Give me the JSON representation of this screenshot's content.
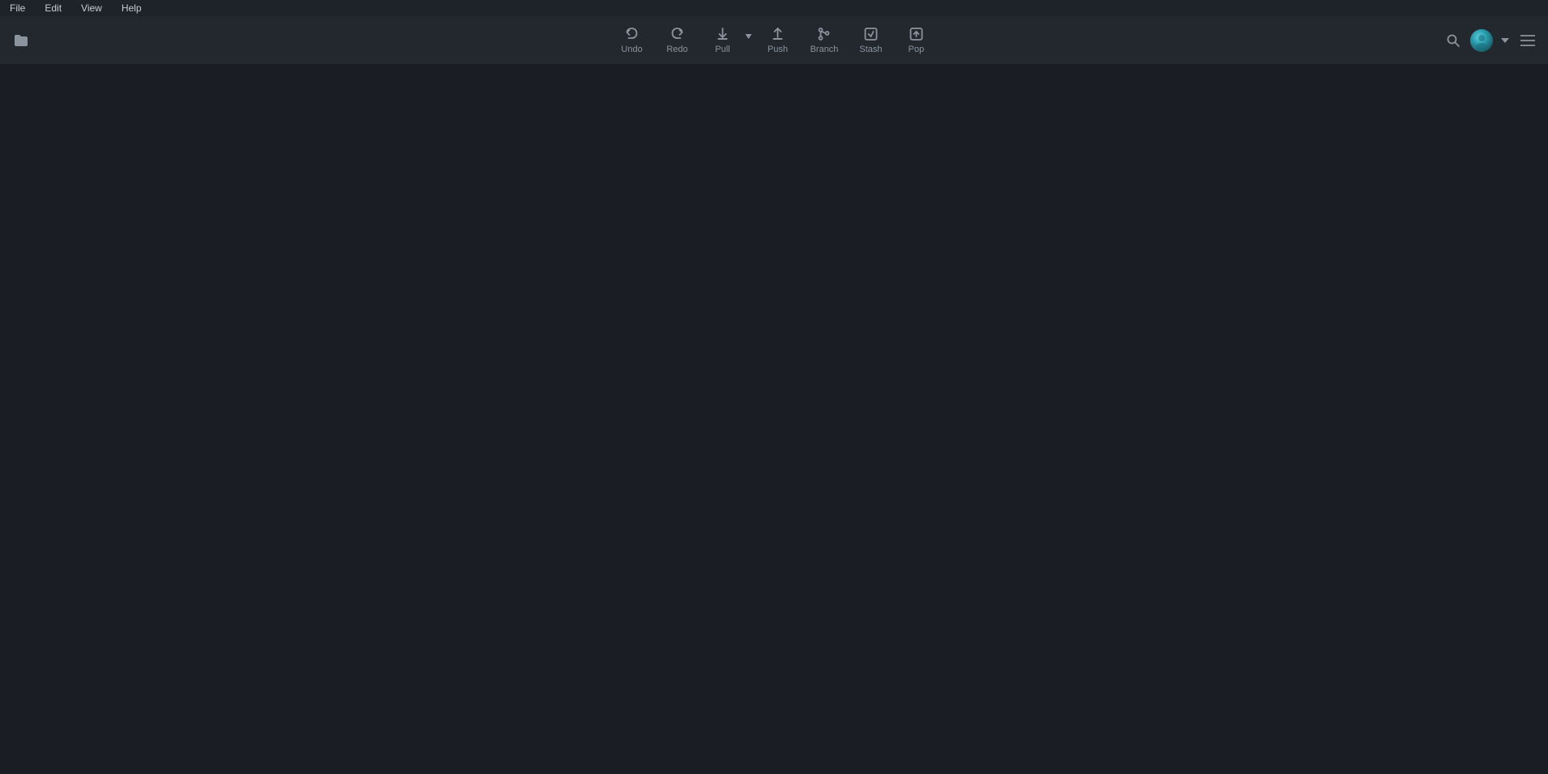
{
  "menu": {
    "items": [
      {
        "id": "file",
        "label": "File"
      },
      {
        "id": "edit",
        "label": "Edit"
      },
      {
        "id": "view",
        "label": "View"
      },
      {
        "id": "help",
        "label": "Help"
      }
    ]
  },
  "toolbar": {
    "buttons": [
      {
        "id": "undo",
        "label": "Undo"
      },
      {
        "id": "redo",
        "label": "Redo"
      },
      {
        "id": "pull",
        "label": "Pull"
      },
      {
        "id": "push",
        "label": "Push"
      },
      {
        "id": "branch",
        "label": "Branch"
      },
      {
        "id": "stash",
        "label": "Stash"
      },
      {
        "id": "pop",
        "label": "Pop"
      }
    ]
  },
  "colors": {
    "toolbar_bg": "#23272e",
    "main_bg": "#1a1d23",
    "text": "#8b949e",
    "accent": "#4db8c8"
  }
}
